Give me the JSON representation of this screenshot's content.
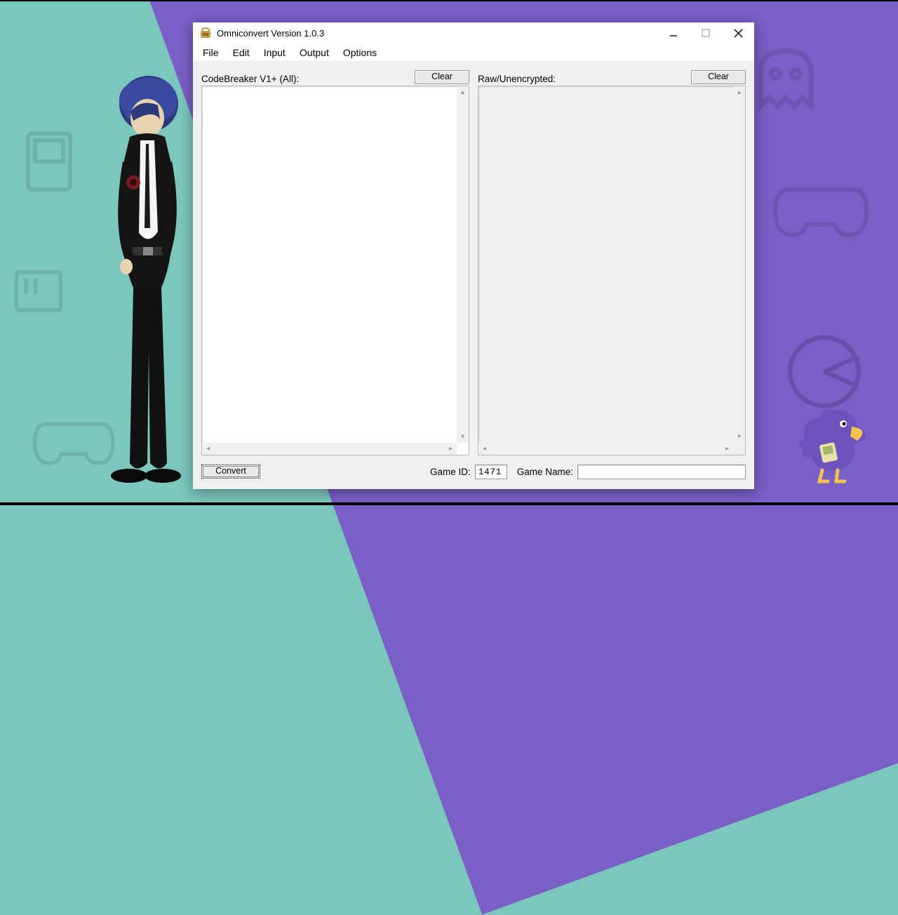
{
  "window": {
    "title": "Omniconvert Version 1.0.3"
  },
  "menu": {
    "file": "File",
    "edit": "Edit",
    "input": "Input",
    "output": "Output",
    "options": "Options"
  },
  "panes": {
    "left": {
      "label": "CodeBreaker V1+ (All):",
      "clear": "Clear"
    },
    "right": {
      "label": "Raw/Unencrypted:",
      "clear": "Clear"
    }
  },
  "bottom": {
    "convert": "Convert",
    "game_id_label": "Game ID:",
    "game_id_value": "1471",
    "game_name_label": "Game Name:",
    "game_name_value": ""
  }
}
